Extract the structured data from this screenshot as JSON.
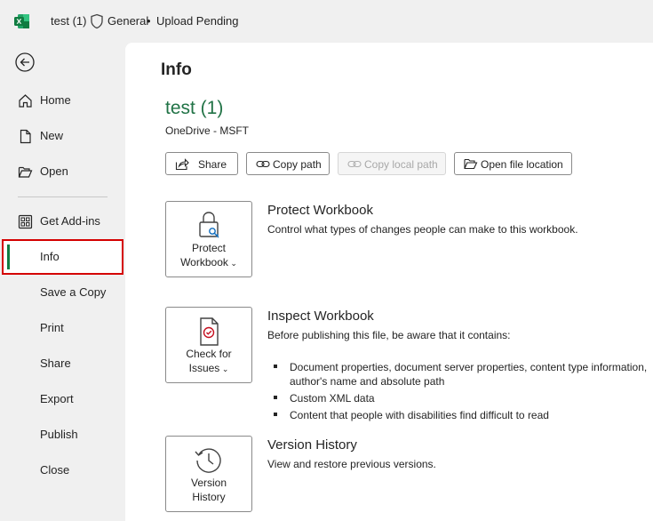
{
  "titlebar": {
    "doc_name": "test (1)",
    "sensitivity_label": "General",
    "separator": "•",
    "upload_status": "Upload Pending"
  },
  "sidebar": {
    "items": [
      {
        "label": "Home",
        "icon": "home-icon"
      },
      {
        "label": "New",
        "icon": "new-document-icon"
      },
      {
        "label": "Open",
        "icon": "folder-open-icon"
      },
      {
        "label": "Get Add-ins",
        "icon": "add-ins-icon"
      },
      {
        "label": "Info",
        "active": true
      },
      {
        "label": "Save a Copy"
      },
      {
        "label": "Print"
      },
      {
        "label": "Share"
      },
      {
        "label": "Export"
      },
      {
        "label": "Publish"
      },
      {
        "label": "Close"
      }
    ]
  },
  "main": {
    "title": "Info",
    "file_title": "test (1)",
    "file_location": "OneDrive - MSFT",
    "buttons": {
      "share": "Share",
      "copy_path": "Copy path",
      "copy_local_path": "Copy local path",
      "open_file_location": "Open file location"
    },
    "protect": {
      "card_line1": "Protect",
      "card_line2": "Workbook",
      "title": "Protect Workbook",
      "desc": "Control what types of changes people can make to this workbook."
    },
    "inspect": {
      "card_line1": "Check for",
      "card_line2": "Issues",
      "title": "Inspect Workbook",
      "desc": "Before publishing this file, be aware that it contains:",
      "bullets": [
        "Document properties, document server properties, content type information, author's name and absolute path",
        "Custom XML data",
        "Content that people with disabilities find difficult to read"
      ]
    },
    "version": {
      "card_line1": "Version",
      "card_line2": "History",
      "title": "Version History",
      "desc": "View and restore previous versions."
    }
  },
  "colors": {
    "accent_green": "#217346",
    "active_border": "#d40000"
  }
}
